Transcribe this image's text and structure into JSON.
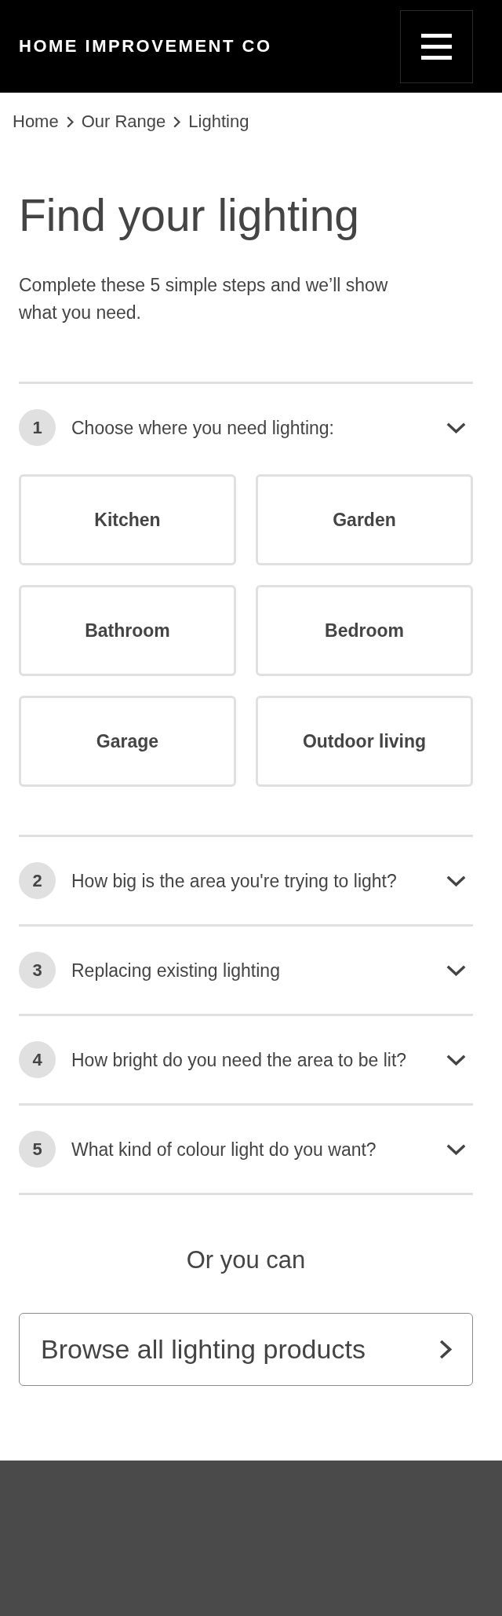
{
  "header": {
    "brand": "HOME IMPROVEMENT CO"
  },
  "breadcrumb": [
    {
      "label": "Home"
    },
    {
      "label": "Our Range"
    },
    {
      "label": "Lighting"
    }
  ],
  "page": {
    "title": "Find your lighting",
    "intro": "Complete these 5 simple steps and we’ll show what you need."
  },
  "steps": [
    {
      "number": "1",
      "question": "Choose where you need lighting:",
      "options": [
        "Kitchen",
        "Garden",
        "Bathroom",
        "Bedroom",
        "Garage",
        "Outdoor living"
      ]
    },
    {
      "number": "2",
      "question": "How big is the area you're trying to light?"
    },
    {
      "number": "3",
      "question": "Replacing existing lighting"
    },
    {
      "number": "4",
      "question": "How bright do you need the area to be lit?"
    },
    {
      "number": "5",
      "question": "What kind of colour light do you want?"
    }
  ],
  "alternative": {
    "heading": "Or you can",
    "button": "Browse all lighting products"
  }
}
